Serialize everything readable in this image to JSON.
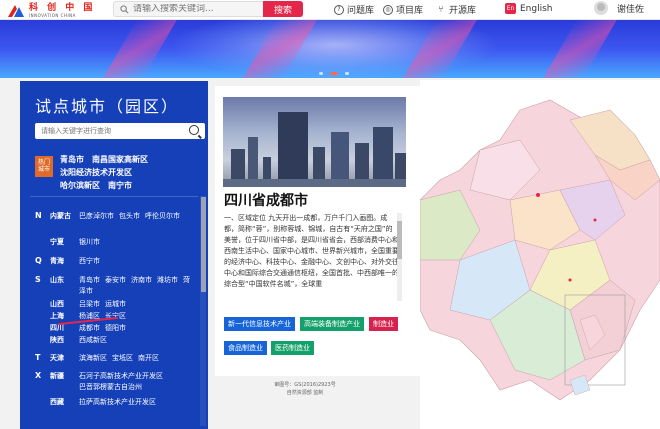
{
  "header": {
    "logo_cn": "科 创 中 国",
    "logo_en": "INNOVATION CHINA",
    "search_placeholder": "请输入搜索关键词...",
    "search_button": "搜索",
    "nav": [
      "问题库",
      "项目库",
      "开源库"
    ],
    "lang_badge": "En",
    "lang_label": "English",
    "user_name": "谢佳佐"
  },
  "sidebar": {
    "title": "试点城市（园区）",
    "search_placeholder": "请输入关键字进行查询",
    "hot_badge": [
      "热门",
      "城市"
    ],
    "hot_cities": [
      "青岛市",
      "南昌国家高新区",
      "沈阳经济技术开发区",
      "哈尔滨新区",
      "南宁市"
    ],
    "regions": [
      {
        "letter": "N",
        "prov": "内蒙古",
        "cities": [
          "巴彦淖尔市",
          "包头市",
          "呼伦贝尔市"
        ]
      },
      {
        "letter": "",
        "prov": "宁夏",
        "cities": [
          "银川市"
        ]
      },
      {
        "letter": "Q",
        "prov": "青海",
        "cities": [
          "西宁市"
        ]
      },
      {
        "letter": "S",
        "prov": "山东",
        "cities": [
          "青岛市",
          "泰安市",
          "济南市",
          "潍坊市",
          "菏泽市"
        ]
      },
      {
        "letter": "",
        "prov": "山西",
        "cities": [
          "吕梁市",
          "运城市"
        ]
      },
      {
        "letter": "",
        "prov": "上海",
        "cities": [
          "杨浦区",
          "长宁区"
        ]
      },
      {
        "letter": "",
        "prov": "四川",
        "cities": [
          "成都市",
          "德阳市"
        ]
      },
      {
        "letter": "",
        "prov": "陕西",
        "cities": [
          "西咸新区"
        ]
      },
      {
        "letter": "T",
        "prov": "天津",
        "cities": [
          "滨海新区",
          "宝坻区",
          "南开区"
        ]
      },
      {
        "letter": "X",
        "prov": "新疆",
        "cities": [
          "石河子高新技术产业开发区",
          "巴音郭楞蒙古自治州"
        ]
      },
      {
        "letter": "",
        "prov": "西藏",
        "cities": [
          "拉萨高新技术产业开发区"
        ]
      }
    ]
  },
  "detail": {
    "city_name": "四川省成都市",
    "description": "一、区域定位 九天开出一成都，万户千门入画图。成都，简称“蓉”，别称蓉城、锦城，自古有“天府之国”的美誉，位于四川省中部，是四川省省会，西部消费中心和西南生活中心、国家中心城市、世界新兴城市，全国重要的经济中心、科技中心、金融中心、文创中心、对外交往中心和国际综合交通通信枢纽，全国首批、中西部唯一的综合型“中国软件名城”，全球重",
    "tags": [
      "新一代信息技术产业",
      "高端装备制造产业",
      "制造业",
      "食品制造业",
      "医药制造业"
    ],
    "footer_line1": "审图号：GS(2016)2923号",
    "footer_line2": "自然资源部 监制"
  },
  "colors": {
    "accent_red": "#e5264b",
    "panel_blue": "#1540b8",
    "tag_blue": "#1565d8",
    "tag_green": "#14a06a",
    "tag_red": "#d6224e"
  }
}
